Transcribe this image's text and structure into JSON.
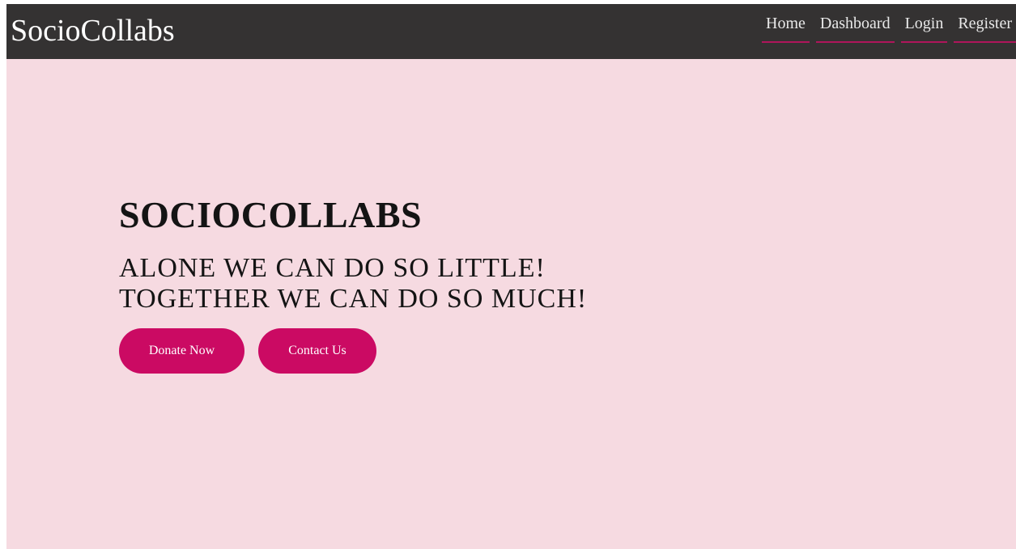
{
  "navbar": {
    "brand": "SocioCollabs",
    "links": [
      {
        "label": "Home"
      },
      {
        "label": "Dashboard"
      },
      {
        "label": "Login"
      },
      {
        "label": "Register"
      }
    ]
  },
  "hero": {
    "title": "SOCIOCOLLABS",
    "tagline_line1": "ALONE WE CAN DO SO LITTLE!",
    "tagline_line2": "TOGETHER WE CAN DO SO MUCH!",
    "donate_label": "Donate Now",
    "contact_label": "Contact Us"
  },
  "colors": {
    "navbar_bg": "#343232",
    "page_bg": "#f6dae1",
    "accent": "#cb0a63",
    "nav_underline": "#b0155b"
  }
}
